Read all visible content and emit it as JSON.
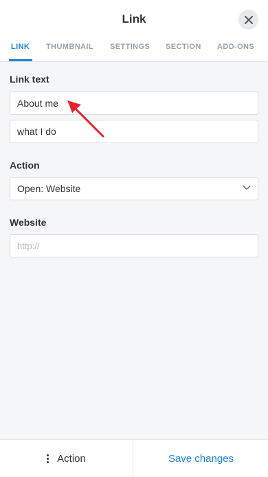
{
  "header": {
    "title": "Link",
    "close_icon": "close-icon"
  },
  "tabs": [
    {
      "label": "LINK",
      "active": true
    },
    {
      "label": "THUMBNAIL",
      "active": false
    },
    {
      "label": "SETTINGS",
      "active": false
    },
    {
      "label": "SECTION",
      "active": false
    },
    {
      "label": "ADD-ONS",
      "active": false
    }
  ],
  "form": {
    "link_text_label": "Link text",
    "link_text_line1": "About me",
    "link_text_line2": "what I do",
    "action_label": "Action",
    "action_value": "Open: Website",
    "website_label": "Website",
    "website_placeholder": "http://"
  },
  "footer": {
    "action_label": "Action",
    "save_label": "Save changes"
  },
  "colors": {
    "accent": "#1a85d6",
    "annotation_arrow": "#e8212d"
  }
}
